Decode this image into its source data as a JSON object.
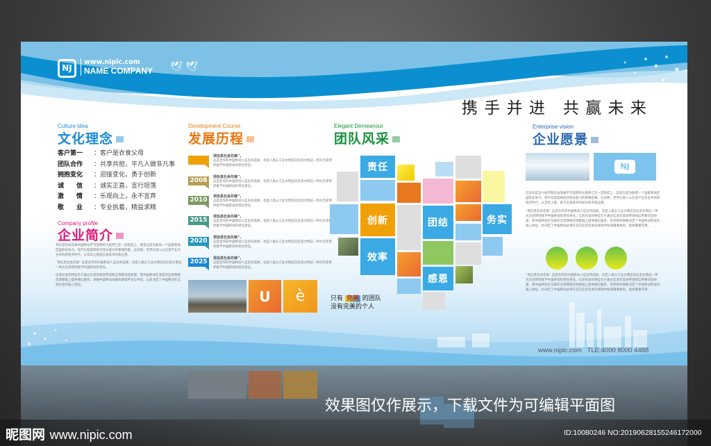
{
  "header": {
    "url": "www.nipic.com",
    "company": "NAME COMPANY",
    "slogan_left": "携 手 并 进",
    "slogan_right": "共 赢 未 来"
  },
  "culture": {
    "subtitle": "Culture Idea",
    "title": "文化理念",
    "rows": [
      {
        "key": "客户第一",
        "value": "：客户是衣食父母"
      },
      {
        "key": "团队合作",
        "value": "：共享共担，平凡人做非凡事"
      },
      {
        "key": "拥抱变化",
        "value": "：迎接变化，勇于创新"
      },
      {
        "key": "诚　　信",
        "value": "：诚实正直，言行坦荡"
      },
      {
        "key": "激　　情",
        "value": "：乐观向上，永不言弃"
      },
      {
        "key": "敬　　业",
        "value": "：专业执着，精益求精"
      }
    ]
  },
  "profile": {
    "subtitle": "Company profile",
    "title": "企业简介",
    "paragraphs": [
      "领信息社会先锋中国移动不可逆转的大趋势它在一定程度上，要变已成为影响一个国家和地区国际竞争力，现代化程度和经济成长能力的重要因素。这说明，世界已进入以信息产业为主导的新经济时代，从实际上看是信息技术的和应用。",
      "“领信息社会先锋” 这是合作的中国移动人自主的选择，也是人类从工业文明迈向信息文明这一伟大历史转折赋予中国移动的责任。",
      "信息社会的特征在于通过信息的高效传递和应用来创造财富，而中国移动在深度的信息网络资源基础上提供通信服务，承载中国移动发展的基础平台与手段，以及决定了中国移动在信息社会的核心地位。"
    ]
  },
  "development": {
    "subtitle": "Development Course",
    "title": "发展历程",
    "entries": [
      {
        "year": "",
        "color": "#f0a10a",
        "heading": "领信息社会先锋”，",
        "text": "这是合作的中国移动人自主的选择，也是人类从工业文明迈向信息文明这一伟大历史转折赋予中国移动的责任责任。"
      },
      {
        "year": "2008",
        "color": "#b59e55",
        "heading": "领信息社会先锋”，",
        "text": "这是合作的中国移动人自主的选择，也是人类从工业文明迈向信息文明这一伟大历史转折赋予中国移动的责任责任。"
      },
      {
        "year": "2010",
        "color": "#7e9a62",
        "heading": "领信息社会先锋”，",
        "text": "这是合作的中国移动人自主的选择，也是人类从工业文明迈向信息文明这一伟大历史转折赋予中国移动的责任责任。"
      },
      {
        "year": "2015",
        "color": "#48998a",
        "heading": "领信息社会先锋”，",
        "text": "这是合作的中国移动人自主的选择，也是人类从工业文明迈向信息文明这一伟大历史转折赋予中国移动的责任责任。"
      },
      {
        "year": "2020",
        "color": "#2399bf",
        "heading": "领信息社会先锋”，",
        "text": "这是合作的中国移动人自主的选择，也是人类从工业文明迈向信息文明这一伟大历史转折赋予中国移动的责任责任。"
      },
      {
        "year": "2025",
        "color": "#1b86d6",
        "heading": "领信息社会先锋”，",
        "text": "这是合作的中国移动人自主的选择，也是人类从工业文明迈向信息文明这一伟大历史转折赋予中国移动的责任责任。"
      }
    ],
    "letters": [
      "U",
      "è"
    ]
  },
  "team": {
    "subtitle": "Elegant Demeanour",
    "title": "团队风采",
    "tiles": [
      "责任",
      "创新",
      "效率",
      "团结",
      "感恩",
      "务实"
    ],
    "motto_prefix": "只有",
    "motto_badge": "完美",
    "motto_suffix": "的团队",
    "motto_line2": "没有完美的个人"
  },
  "vision": {
    "subtitle": "Enterprise vision",
    "title": "企业愿景",
    "paragraphs": [
      "信息化是当今经济和社会发展不可逆转的大趋势它在一定程度上，是变已成为衡量一个国家和地区国际竞争力，现代化程度和经济成长能力的重要因素。这说明，世界已进入以信息产业为主导的新经济时代，从实际上看，基于信息技术的知识经济和运用。",
      "“领信息社会先锋” 这是合作的中国移动人自主的选择，也是人类从工业文明迈向信息文明这一伟大历史转折赋予中国移动的责任责任。信息社会的特征在于通过信息的高效传递和应用来创造财富，而中国移动在深度的信息网络资源基础上提供通信服务，其完善的网络决定了中国移动所处的核心地位，也决定了中国移动必将在走向信息社会的进程中扮演重要角色，发挥重要作用。",
      "“领信息社会先锋” 这是合作的中国移动人自主的选择，也是人类从工业文明迈向信息文明这一伟大历史转折赋予中国移动的责任责任。信息社会的特征在于通过信息的高效传递和应用来创造财富，而中国移动在深度的信息网络资源基础上提供通信服务，其完善的网络决定了中国移动所处的核心地位，也决定了中国移动必将在走向信息社会的进程中扮演重要角色，发挥重要作用。"
    ]
  },
  "footer": {
    "contact": "www.nipic.com   TLE:4000 8000 4488"
  },
  "overlay": {
    "notice": "效果图仅作展示，下载文件为可编辑平面图",
    "site_logo": "昵图网",
    "site_url": "www.nipic.com",
    "id_text": "ID:10080246 NO:20190628155246172000"
  },
  "colors": {
    "culture": "#1a8ad4",
    "profile": "#e0187a",
    "development": "#e8770f",
    "team": "#15903a",
    "vision": "#2a6ab0",
    "tile_blue": "#3aa9e4"
  }
}
